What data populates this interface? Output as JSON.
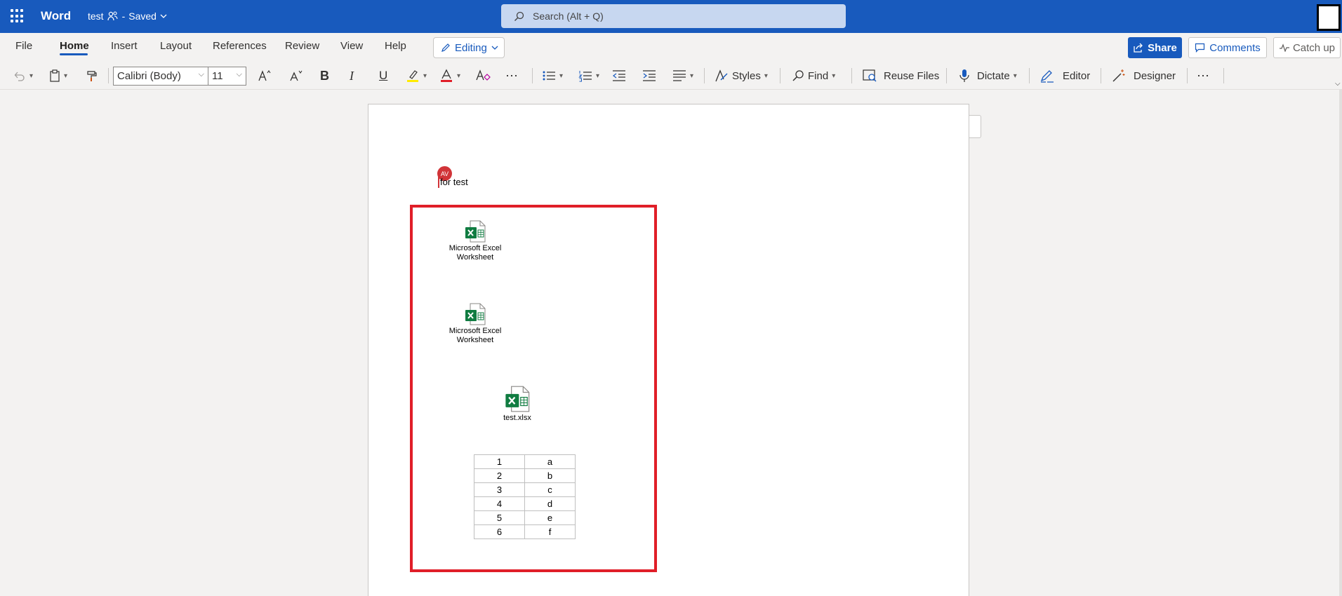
{
  "app": {
    "name": "Word",
    "doc_title": "test",
    "saved_status": "Saved",
    "separator": "-"
  },
  "search": {
    "placeholder": "Search (Alt + Q)"
  },
  "menu": {
    "items": [
      "File",
      "Home",
      "Insert",
      "Layout",
      "References",
      "Review",
      "View",
      "Help"
    ],
    "active": "Home",
    "editing_label": "Editing",
    "share_label": "Share",
    "comments_label": "Comments",
    "catchup_label": "Catch up"
  },
  "ribbon": {
    "font_name": "Calibri (Body)",
    "font_size": "11",
    "bold": "B",
    "italic": "I",
    "underline": "U",
    "styles_label": "Styles",
    "find_label": "Find",
    "reuse_label": "Reuse Files",
    "dictate_label": "Dictate",
    "editor_label": "Editor",
    "designer_label": "Designer",
    "more": "⋯"
  },
  "document": {
    "author_initials": "AV",
    "first_line": "for test",
    "objects": [
      {
        "label_line1": "Microsoft Excel",
        "label_line2": "Worksheet"
      },
      {
        "label_line1": "Microsoft Excel",
        "label_line2": "Worksheet"
      },
      {
        "label_line1": "test.xlsx",
        "label_line2": ""
      }
    ],
    "table": [
      [
        "1",
        "a"
      ],
      [
        "2",
        "b"
      ],
      [
        "3",
        "c"
      ],
      [
        "4",
        "d"
      ],
      [
        "5",
        "e"
      ],
      [
        "6",
        "f"
      ]
    ]
  },
  "colors": {
    "brand": "#185abd",
    "highlight_red": "#e01e28",
    "excel_green": "#107c41"
  }
}
